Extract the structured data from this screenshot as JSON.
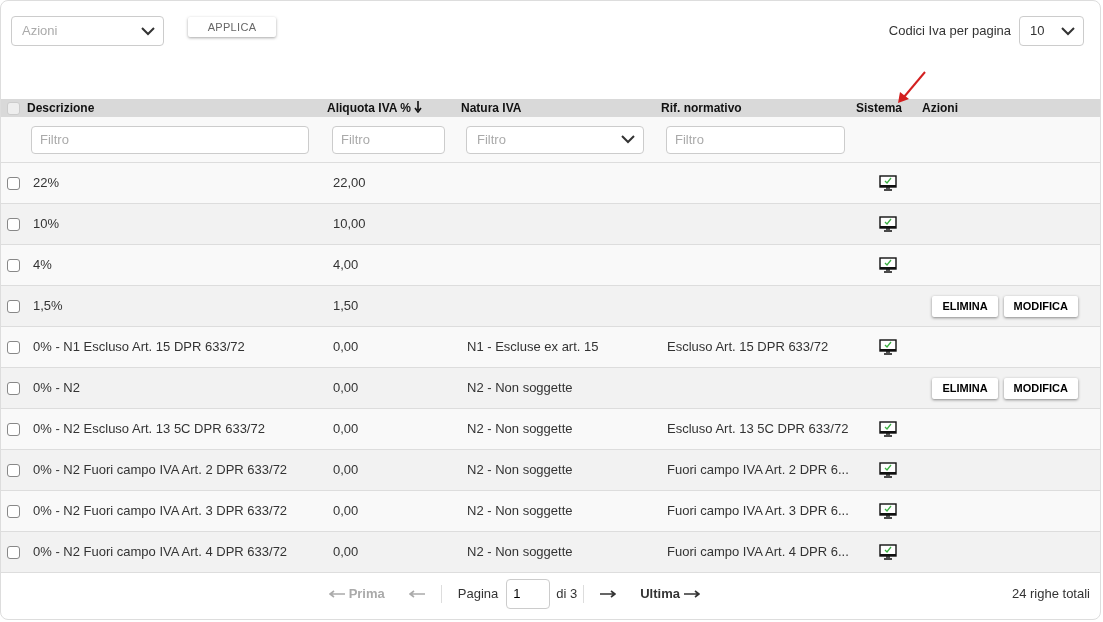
{
  "toolbar": {
    "actions_select": {
      "placeholder": "Azioni"
    },
    "apply_button": "APPLICA",
    "per_page_label": "Codici Iva per pagina",
    "per_page_value": "10"
  },
  "table": {
    "select_all_checked": false,
    "columns": [
      {
        "label": "Descrizione",
        "sorted": false
      },
      {
        "label": "Aliquota IVA %",
        "sorted": true
      },
      {
        "label": "Natura IVA",
        "sorted": false
      },
      {
        "label": "Rif. normativo",
        "sorted": false
      },
      {
        "label": "Sistema",
        "sorted": false
      },
      {
        "label": "Azioni",
        "sorted": false
      }
    ],
    "filters": [
      {
        "kind": "text",
        "placeholder": "Filtro"
      },
      {
        "kind": "text",
        "placeholder": "Filtro"
      },
      {
        "kind": "select",
        "placeholder": "Filtro"
      },
      {
        "kind": "text",
        "placeholder": "Filtro"
      }
    ],
    "rows": [
      {
        "checked": false,
        "descrizione": "22%",
        "aliquota": "22,00",
        "natura": "",
        "rif": "",
        "system": true,
        "actions": []
      },
      {
        "checked": false,
        "descrizione": "10%",
        "aliquota": "10,00",
        "natura": "",
        "rif": "",
        "system": true,
        "actions": []
      },
      {
        "checked": false,
        "descrizione": "4%",
        "aliquota": "4,00",
        "natura": "",
        "rif": "",
        "system": true,
        "actions": []
      },
      {
        "checked": false,
        "descrizione": "1,5%",
        "aliquota": "1,50",
        "natura": "",
        "rif": "",
        "system": false,
        "actions": [
          "ELIMINA",
          "MODIFICA"
        ]
      },
      {
        "checked": false,
        "descrizione": "0% - N1 Escluso Art. 15 DPR 633/72",
        "aliquota": "0,00",
        "natura": "N1 - Escluse ex art. 15",
        "rif": "Escluso Art. 15 DPR 633/72",
        "system": true,
        "actions": []
      },
      {
        "checked": false,
        "descrizione": "0% - N2",
        "aliquota": "0,00",
        "natura": "N2 - Non soggette",
        "rif": "",
        "system": false,
        "actions": [
          "ELIMINA",
          "MODIFICA"
        ]
      },
      {
        "checked": false,
        "descrizione": "0% - N2 Escluso Art. 13 5C DPR 633/72",
        "aliquota": "0,00",
        "natura": "N2 - Non soggette",
        "rif": "Escluso Art. 13 5C DPR 633/72",
        "system": true,
        "actions": []
      },
      {
        "checked": false,
        "descrizione": "0% - N2 Fuori campo IVA Art. 2 DPR 633/72",
        "aliquota": "0,00",
        "natura": "N2 - Non soggette",
        "rif": "Fuori campo IVA Art. 2 DPR 6...",
        "system": true,
        "actions": []
      },
      {
        "checked": false,
        "descrizione": "0% - N2 Fuori campo IVA Art. 3 DPR 633/72",
        "aliquota": "0,00",
        "natura": "N2 - Non soggette",
        "rif": "Fuori campo IVA Art. 3 DPR 6...",
        "system": true,
        "actions": []
      },
      {
        "checked": false,
        "descrizione": "0% - N2 Fuori campo IVA Art. 4 DPR 633/72",
        "aliquota": "0,00",
        "natura": "N2 - Non soggette",
        "rif": "Fuori campo IVA Art. 4 DPR 6...",
        "system": true,
        "actions": []
      }
    ]
  },
  "pager": {
    "first": {
      "label": "Prima",
      "disabled": true
    },
    "prev_disabled": true,
    "page_label": "Pagina",
    "page_value": "1",
    "of_label": "di 3",
    "next_disabled": false,
    "last": {
      "label": "Ultima",
      "disabled": false
    },
    "total": "24 righe totali"
  }
}
